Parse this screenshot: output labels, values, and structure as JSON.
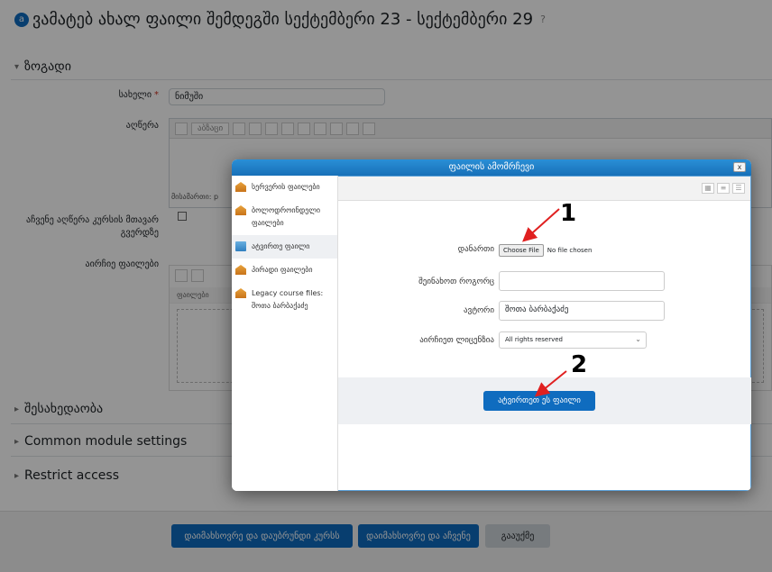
{
  "page": {
    "title": "ვამატებ ახალ ფაილი შემდეგში სექტემბერი 23 - სექტემბერი 29",
    "title_badge": "a",
    "help_glyph": "?"
  },
  "sections": {
    "general": "ზოგადი",
    "appearance": "შესახედაობა",
    "common_module": "Common module settings",
    "restrict": "Restrict access"
  },
  "form": {
    "name_label": "სახელი",
    "required_glyph": "*",
    "name_value": "ნიმუში",
    "description_label": "აღწერა",
    "editor_paragraph_select": "აბზაცი",
    "editor_path": "მისამართი: p",
    "show_description_label": "აჩვენე აღწერა კურსის მთავარ გვერდზე",
    "select_files_label": "აირჩიე ფაილები",
    "fm_breadcrumb": "ფაილები"
  },
  "dialog": {
    "title": "ფაილის ამომრჩევი",
    "close": "x",
    "sidebar": [
      {
        "label": "სერვერის ფაილები",
        "icon": "repository-icon"
      },
      {
        "label": "ბოლოდროინდელი ფაილები",
        "icon": "repository-icon"
      },
      {
        "label": "ატვირთე ფაილი",
        "icon": "upload-icon"
      },
      {
        "label": "პირადი ფაილები",
        "icon": "repository-icon"
      },
      {
        "label": "Legacy course files: შოთა ბარბაქაძე",
        "icon": "repository-icon"
      }
    ],
    "attachment_label": "დანართი",
    "choose_file": "Choose File",
    "no_file": "No file chosen",
    "save_as_label": "შეინახოთ როგორც",
    "save_as_value": "",
    "author_label": "ავტორი",
    "author_value": "შოთა ბარბაქაძე",
    "license_label": "აირჩიეთ ლიცენზია",
    "license_value": "All rights reserved",
    "upload_button": "ატვირთეთ ეს ფაილი"
  },
  "annotations": {
    "step1": "1",
    "step2": "2"
  },
  "footer": {
    "save_return": "დაიმახსოვრე და დაუბრუნდი კურსს",
    "save_display": "დაიმახსოვრე და აჩვენე",
    "cancel": "გააუქმე"
  },
  "colors": {
    "primary": "#0f6cbf",
    "annotation_arrow": "#e02020"
  }
}
